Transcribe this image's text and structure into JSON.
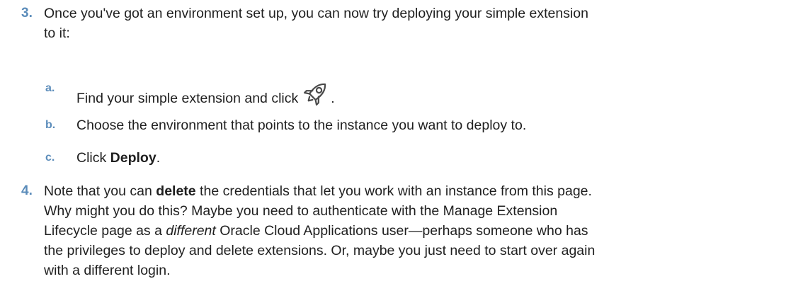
{
  "steps": {
    "s3": {
      "number": "3.",
      "text": "Once you've got an environment set up, you can now try deploying your simple extension to it:",
      "line1": "Once you've got an environment set up, you can now try deploying your simple extension",
      "line2": "to it:"
    },
    "s3a": {
      "letter": "a.",
      "text": "Find your simple extension and click",
      "after": "."
    },
    "s3b": {
      "letter": "b.",
      "text": "Choose the environment that points to the instance you want to deploy to."
    },
    "s3c": {
      "letter": "c.",
      "before": "Click ",
      "bold": "Deploy",
      "after": "."
    },
    "s4": {
      "number": "4.",
      "l1_before": "Note that you can ",
      "l1_bold": "delete",
      "l1_after": " the credentials that let you work with an instance from this page.",
      "l2": "Why might you do this? Maybe you need to authenticate with the Manage Extension",
      "l3_before": "Lifecycle page as a ",
      "l3_italic": "different",
      "l3_after": " Oracle Cloud Applications user—perhaps someone who has",
      "l4": "the privileges to deploy and delete extensions. Or, maybe you just need to start over again",
      "l5": "with a different login."
    }
  },
  "icons": {
    "deploy": "rocket-icon"
  },
  "colors": {
    "list_marker": "#5b8cba",
    "text": "#1f1f1f"
  }
}
